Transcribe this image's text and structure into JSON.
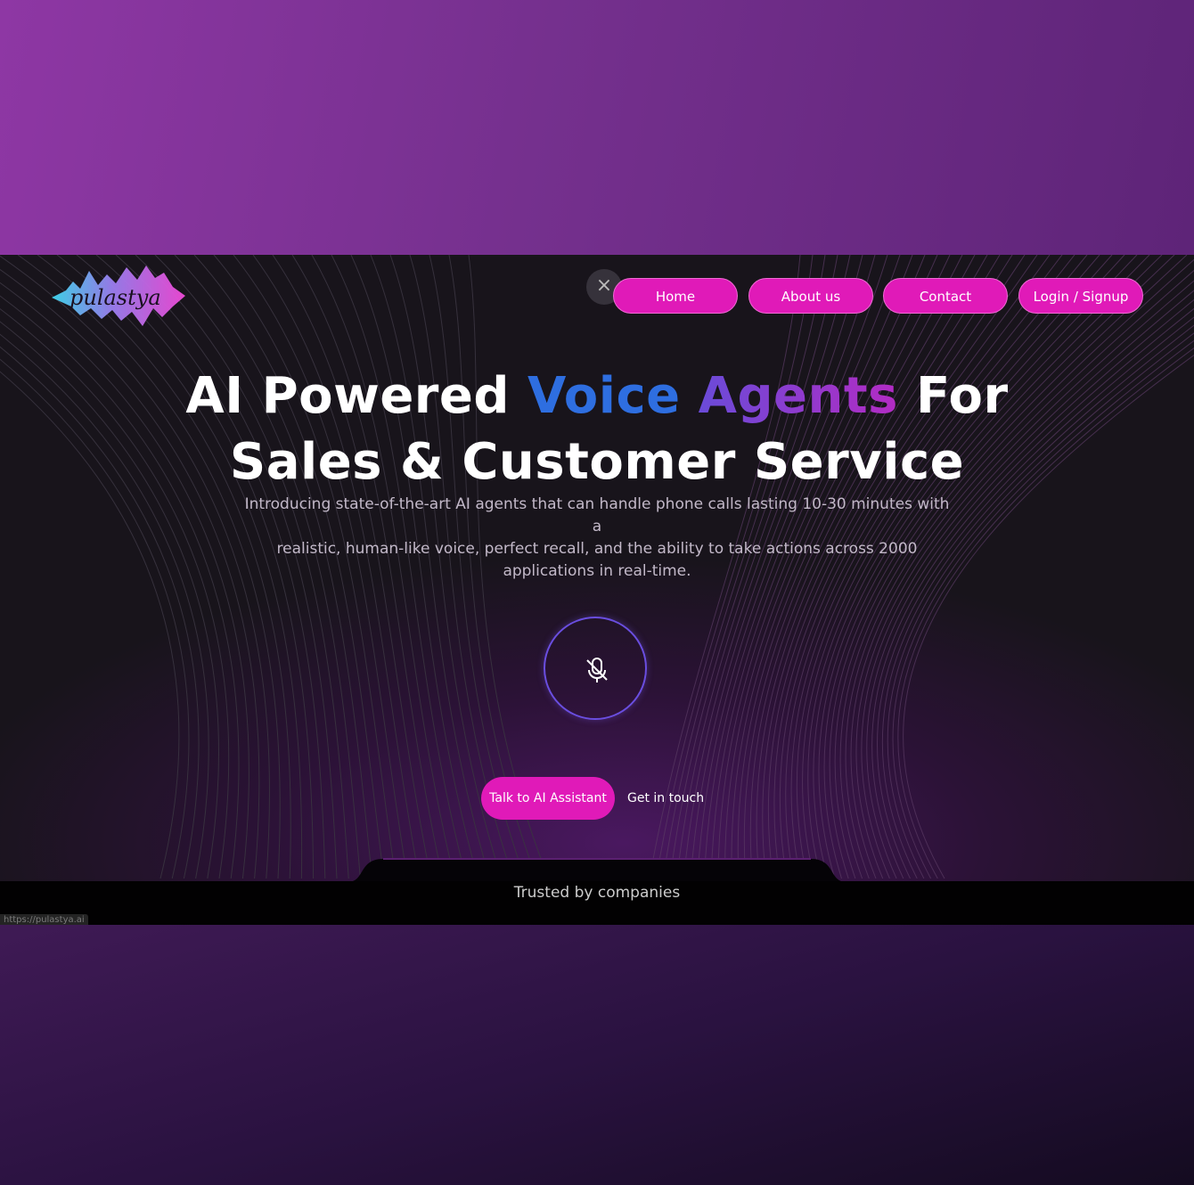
{
  "brand": {
    "logo_text": "pulastya"
  },
  "nav": {
    "close_icon": "×",
    "items": [
      {
        "label": "Home"
      },
      {
        "label": "About us"
      },
      {
        "label": "Contact"
      },
      {
        "label": "Login / Signup"
      }
    ]
  },
  "hero": {
    "title_part1": "AI Powered ",
    "title_voice": "Voice",
    "title_agents": "Agents",
    "title_part2": " For",
    "title_line2": "Sales & Customer Service",
    "intro_line1": "Introducing state-of-the-art AI agents that can handle phone calls lasting 10-30 minutes with a",
    "intro_line2": "realistic, human-like voice, perfect recall, and the ability to take actions across 2000",
    "intro_line3": "applications in real-time.",
    "mic_icon": "mic-off-icon",
    "cta_primary": "Talk to AI Assistant",
    "cta_secondary": "Get in touch"
  },
  "trusted": {
    "label": "Trusted by companies"
  },
  "status": {
    "url": "https://pulastya.ai"
  },
  "colors": {
    "accent": "#e01ab8",
    "voice_blue": "#2e6ee0",
    "agents_purple": "#9a35c8",
    "background": "#1a161c"
  }
}
